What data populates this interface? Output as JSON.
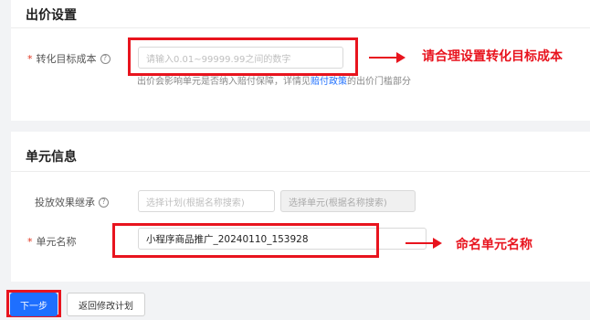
{
  "bid_section": {
    "title": "出价设置",
    "target_cost_label": "转化目标成本",
    "target_cost_placeholder": "请输入0.01~99999.99之间的数字",
    "hint_before": "出价会影响单元是否纳入赔付保障，详情见",
    "hint_link": "赔付政策",
    "hint_after": "的出价门槛部分"
  },
  "unit_section": {
    "title": "单元信息",
    "inherit_label": "投放效果继承",
    "plan_placeholder": "选择计划(根据名称搜索)",
    "unit_placeholder": "选择单元(根据名称搜索)",
    "unit_name_label": "单元名称",
    "unit_name_value": "小程序商品推广_20240110_153928"
  },
  "annotations": {
    "cost_note": "请合理设置转化目标成本",
    "name_note": "命名单元名称"
  },
  "footer": {
    "next_label": "下一步",
    "back_label": "返回修改计划"
  },
  "colors": {
    "primary": "#1e6fff",
    "highlight": "#e8141e",
    "required": "#e0341f"
  }
}
